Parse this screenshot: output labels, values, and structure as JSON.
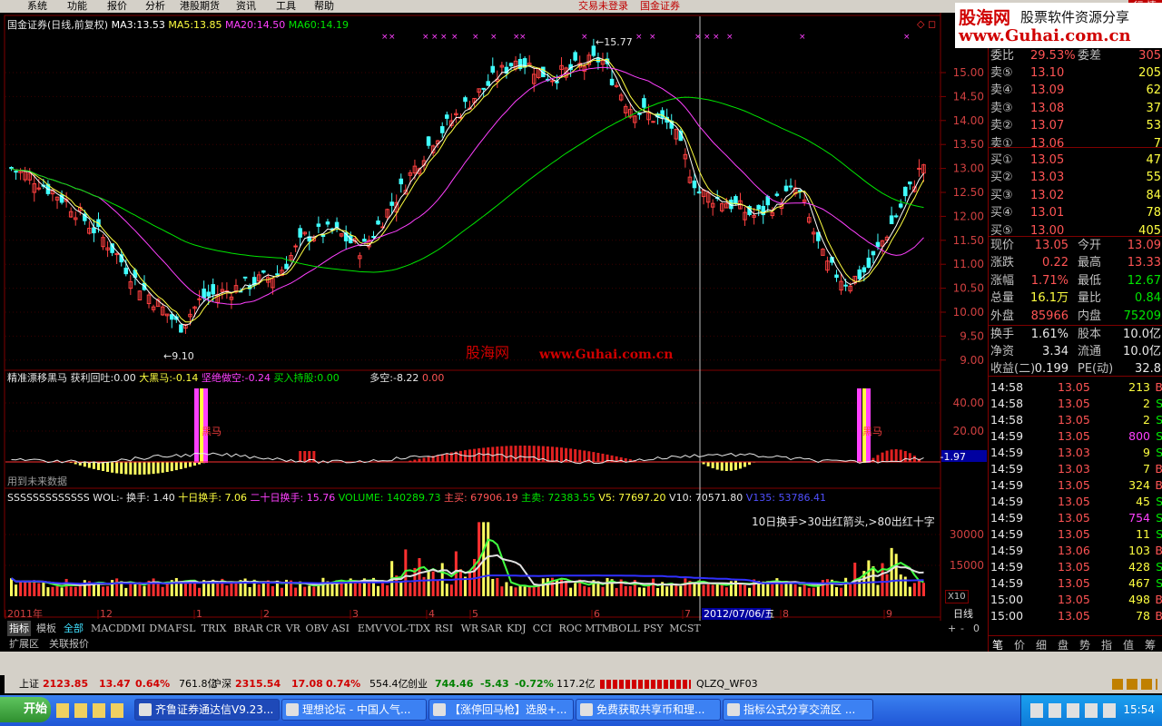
{
  "menu": {
    "items": [
      "系统",
      "功能",
      "报价",
      "分析",
      "港股期货",
      "资讯",
      "工具",
      "帮助"
    ],
    "notice": "交易未登录",
    "broker": "国金证券",
    "right_label": "行 情"
  },
  "logo": {
    "line1": "股海网",
    "line1b": "股票软件资源分享",
    "line2": "www.Guhai.com.cn"
  },
  "main": {
    "title": "国金证券(日线,前复权)",
    "ma": [
      {
        "label": "MA3:",
        "value": "13.53",
        "color": "#ffffff"
      },
      {
        "label": "MA5:",
        "value": "13.85",
        "color": "#ffff40"
      },
      {
        "label": "MA20:",
        "value": "14.50",
        "color": "#ff40ff"
      },
      {
        "label": "MA60:",
        "value": "14.19",
        "color": "#00e600"
      }
    ],
    "price_axis": [
      "15.00",
      "14.50",
      "14.00",
      "13.50",
      "13.00",
      "12.50",
      "12.00",
      "11.50",
      "11.00",
      "10.50",
      "10.00",
      "9.50",
      "9.00"
    ],
    "high_label": "15.77",
    "low_label": "9.10",
    "watermark_cn": "股海网",
    "watermark_url": "www.Guhai.com.cn"
  },
  "ind1": {
    "name": "精准漂移黑马",
    "items": [
      {
        "label": "获利回吐:",
        "value": "0.00",
        "color": "#e8e8e8"
      },
      {
        "label": "大黑马:",
        "value": "-0.14",
        "color": "#ffff40"
      },
      {
        "label": "坚绝做空:",
        "value": "-0.24",
        "color": "#ff40ff"
      },
      {
        "label": "买入持股:",
        "value": "0.00",
        "color": "#00e600"
      },
      {
        "label": "多空:",
        "value": "-8.22",
        "color": "#e8e8e8"
      },
      {
        "label": "",
        "value": "0.00",
        "color": "#ff5454"
      }
    ],
    "axis": [
      "40.00",
      "20.00"
    ],
    "cur_value": "-1.97",
    "marker": "黑马",
    "future_note": "用到未来数据"
  },
  "ind2": {
    "prefix": "SSSSSSSSSSSSS",
    "items": [
      {
        "text": "WOL:- 换手: 1.40",
        "color": "#e8e8e8"
      },
      {
        "text": "十日换手: 7.06",
        "color": "#ffff40"
      },
      {
        "text": "二十日换手: 15.76",
        "color": "#ff40ff"
      },
      {
        "text": "VOLUME: 140289.73",
        "color": "#00e600"
      },
      {
        "text": "主买: 67906.19",
        "color": "#ff5454"
      },
      {
        "text": "主卖: 72383.55",
        "color": "#00e600"
      },
      {
        "text": "V5: 77697.20",
        "color": "#ffff40"
      },
      {
        "text": "V10: 70571.80",
        "color": "#e8e8e8"
      },
      {
        "text": "V135: 53786.41",
        "color": "#5050ff"
      }
    ],
    "axis": [
      "30000",
      "15000"
    ],
    "note": "10日换手>30出红箭头,>80出红十字",
    "unit": "X10"
  },
  "xaxis": {
    "labels": [
      "2011年",
      "12",
      "1",
      "2",
      "3",
      "4",
      "5",
      "6",
      "7",
      "8",
      "9"
    ],
    "cursor_date": "2012/07/06/五",
    "period": "日线"
  },
  "tabs": {
    "left": [
      "指标",
      "模板",
      "全部"
    ],
    "items": [
      "MACD",
      "DMI",
      "DMA",
      "FSL",
      "TRIX",
      "BRAR",
      "CR",
      "VR",
      "OBV",
      "ASI",
      "EMV",
      "VOL-TDX",
      "RSI",
      "WR",
      "SAR",
      "KDJ",
      "CCI",
      "ROC",
      "MTM",
      "BOLL",
      "PSY",
      "MCST"
    ],
    "ext": [
      "扩展区",
      "关联报价"
    ]
  },
  "quote": {
    "ratio": {
      "label": "委比",
      "value": "29.53%",
      "label2": "委差",
      "value2": "305"
    },
    "asks": [
      {
        "label": "卖⑤",
        "price": "13.10",
        "vol": "205"
      },
      {
        "label": "卖④",
        "price": "13.09",
        "vol": "62"
      },
      {
        "label": "卖③",
        "price": "13.08",
        "vol": "37"
      },
      {
        "label": "卖②",
        "price": "13.07",
        "vol": "53"
      },
      {
        "label": "卖①",
        "price": "13.06",
        "vol": "7"
      }
    ],
    "bids": [
      {
        "label": "买①",
        "price": "13.05",
        "vol": "47"
      },
      {
        "label": "买②",
        "price": "13.03",
        "vol": "55"
      },
      {
        "label": "买③",
        "price": "13.02",
        "vol": "84"
      },
      {
        "label": "买④",
        "price": "13.01",
        "vol": "78"
      },
      {
        "label": "买⑤",
        "price": "13.00",
        "vol": "405"
      }
    ],
    "stats": [
      {
        "l1": "现价",
        "v1": "13.05",
        "c1": "#ff5454",
        "l2": "今开",
        "v2": "13.09",
        "c2": "#ff5454"
      },
      {
        "l1": "涨跌",
        "v1": "0.22",
        "c1": "#ff5454",
        "l2": "最高",
        "v2": "13.33",
        "c2": "#ff5454"
      },
      {
        "l1": "涨幅",
        "v1": "1.71%",
        "c1": "#ff5454",
        "l2": "最低",
        "v2": "12.67",
        "c2": "#00e600"
      },
      {
        "l1": "总量",
        "v1": "16.1万",
        "c1": "#ffff40",
        "l2": "量比",
        "v2": "0.84",
        "c2": "#00e600"
      },
      {
        "l1": "外盘",
        "v1": "85966",
        "c1": "#ff5454",
        "l2": "内盘",
        "v2": "75209",
        "c2": "#00e600"
      }
    ],
    "stats2": [
      {
        "l1": "换手",
        "v1": "1.61%",
        "l2": "股本",
        "v2": "10.0亿"
      },
      {
        "l1": "净资",
        "v1": "3.34",
        "l2": "流通",
        "v2": "10.0亿"
      },
      {
        "l1": "收益(二)",
        "v1": "0.199",
        "l2": "PE(动)",
        "v2": "32.8"
      }
    ],
    "ticks": [
      [
        "14:58",
        "13.05",
        "213",
        "B"
      ],
      [
        "14:58",
        "13.05",
        "2",
        "S"
      ],
      [
        "14:58",
        "13.05",
        "2",
        "S"
      ],
      [
        "14:59",
        "13.05",
        "800",
        "S"
      ],
      [
        "14:59",
        "13.03",
        "9",
        "S"
      ],
      [
        "14:59",
        "13.03",
        "7",
        "B"
      ],
      [
        "14:59",
        "13.05",
        "324",
        "B"
      ],
      [
        "14:59",
        "13.05",
        "45",
        "S"
      ],
      [
        "14:59",
        "13.05",
        "754",
        "S"
      ],
      [
        "14:59",
        "13.05",
        "11",
        "S"
      ],
      [
        "14:59",
        "13.06",
        "103",
        "B"
      ],
      [
        "14:59",
        "13.05",
        "428",
        "S"
      ],
      [
        "14:59",
        "13.05",
        "467",
        "S"
      ],
      [
        "15:00",
        "13.05",
        "498",
        "B"
      ],
      [
        "15:00",
        "13.05",
        "78",
        "B"
      ]
    ],
    "bottom_tabs": [
      "笔",
      "价",
      "细",
      "盘",
      "势",
      "指",
      "值",
      "筹"
    ]
  },
  "status": {
    "sh_label": "上证",
    "sh_val": "2123.85",
    "sh_chg": "13.47",
    "sh_pct": "0.64%",
    "sh_amt": "761.8亿",
    "sz_label": "沪深",
    "sz_val": "2315.54",
    "sz_chg": "17.08",
    "sz_pct": "0.74%",
    "sz_amt": "554.4亿",
    "cy_label": "创业",
    "cy_val": "744.46",
    "cy_chg": "-5.43",
    "cy_pct": "-0.72%",
    "cy_amt": "117.2亿",
    "server": "QLZQ_WF03"
  },
  "taskbar": {
    "start": "开始",
    "items": [
      "齐鲁证券通达信V9.23...",
      "理想论坛 - 中国人气...",
      "【涨停回马枪】选股+...",
      "免费获取共享币和理...",
      "指标公式分享交流区 ..."
    ],
    "clock": "15:54"
  },
  "colors": {
    "up": "#ff5454",
    "down": "#00e600",
    "ma3": "#ffffff",
    "ma5": "#ffff40",
    "ma20": "#ff40ff",
    "ma60": "#00e600",
    "grid": "#800000"
  }
}
